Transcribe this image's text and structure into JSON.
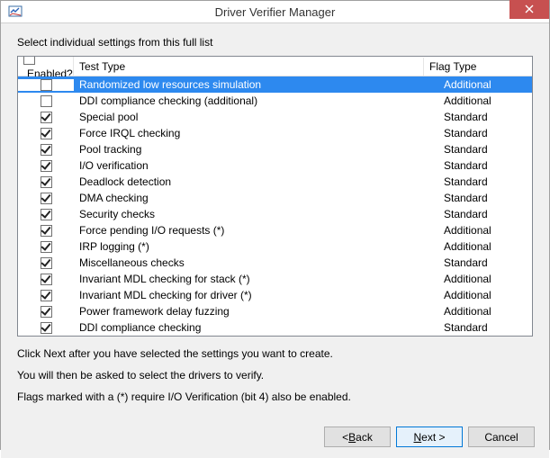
{
  "window": {
    "title": "Driver Verifier Manager"
  },
  "instruction": "Select individual settings from this full list",
  "columns": {
    "enabled": "Enabled?",
    "test": "Test Type",
    "flag": "Flag Type"
  },
  "rows": [
    {
      "enabled": false,
      "test": "Randomized low resources simulation",
      "flag": "Additional",
      "selected": true
    },
    {
      "enabled": false,
      "test": "DDI compliance checking (additional)",
      "flag": "Additional",
      "selected": false
    },
    {
      "enabled": true,
      "test": "Special pool",
      "flag": "Standard",
      "selected": false
    },
    {
      "enabled": true,
      "test": "Force IRQL checking",
      "flag": "Standard",
      "selected": false
    },
    {
      "enabled": true,
      "test": "Pool tracking",
      "flag": "Standard",
      "selected": false
    },
    {
      "enabled": true,
      "test": "I/O verification",
      "flag": "Standard",
      "selected": false
    },
    {
      "enabled": true,
      "test": "Deadlock detection",
      "flag": "Standard",
      "selected": false
    },
    {
      "enabled": true,
      "test": "DMA checking",
      "flag": "Standard",
      "selected": false
    },
    {
      "enabled": true,
      "test": "Security checks",
      "flag": "Standard",
      "selected": false
    },
    {
      "enabled": true,
      "test": "Force pending I/O requests (*)",
      "flag": "Additional",
      "selected": false
    },
    {
      "enabled": true,
      "test": "IRP logging (*)",
      "flag": "Additional",
      "selected": false
    },
    {
      "enabled": true,
      "test": "Miscellaneous checks",
      "flag": "Standard",
      "selected": false
    },
    {
      "enabled": true,
      "test": "Invariant MDL checking for stack (*)",
      "flag": "Additional",
      "selected": false
    },
    {
      "enabled": true,
      "test": "Invariant MDL checking for driver (*)",
      "flag": "Additional",
      "selected": false
    },
    {
      "enabled": true,
      "test": "Power framework delay fuzzing",
      "flag": "Additional",
      "selected": false
    },
    {
      "enabled": true,
      "test": "DDI compliance checking",
      "flag": "Standard",
      "selected": false
    }
  ],
  "notes": {
    "line1": "Click Next after you have selected the settings you want to create.",
    "line2": "You will then be asked to select the drivers to verify.",
    "line3": "Flags marked with a (*) require I/O Verification (bit 4) also be enabled."
  },
  "buttons": {
    "back_prefix": "< ",
    "back_u": "B",
    "back_rest": "ack",
    "next_u": "N",
    "next_rest": "ext >",
    "cancel": "Cancel"
  }
}
